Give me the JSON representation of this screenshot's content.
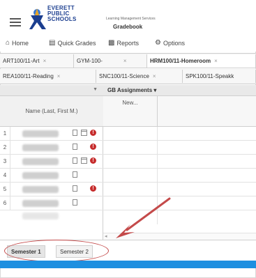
{
  "header": {
    "logo_lines": [
      "EVERETT",
      "PUBLIC",
      "SCHOOLS"
    ],
    "subtitle": "Learning Management Services",
    "app_title": "Gradebook"
  },
  "toolbar": {
    "home": "Home",
    "quick_grades": "Quick Grades",
    "reports": "Reports",
    "options": "Options"
  },
  "class_tabs_row1": [
    {
      "label": "ART100/11-Art",
      "active": false
    },
    {
      "label": "GYM-100-",
      "active": false
    },
    {
      "label": "HRM100/11-Homeroom",
      "active": true
    }
  ],
  "class_tabs_row2": [
    {
      "label": "REA100/11-Reading",
      "active": false
    },
    {
      "label": "SNC100/11-Science",
      "active": false
    },
    {
      "label": "SPK100/11-Speakk",
      "active": false
    }
  ],
  "grid": {
    "name_header": "Name (Last, First M.)",
    "assignments_header": "GB Assignments",
    "new_column": "New...",
    "rows": [
      {
        "num": "1",
        "cal": true,
        "warn": true
      },
      {
        "num": "2",
        "cal": false,
        "warn": true
      },
      {
        "num": "3",
        "cal": true,
        "warn": true
      },
      {
        "num": "4",
        "cal": false,
        "warn": false
      },
      {
        "num": "5",
        "cal": false,
        "warn": true
      },
      {
        "num": "6",
        "cal": false,
        "warn": false
      }
    ]
  },
  "semester_tabs": [
    {
      "label": "Semester 1",
      "active": true
    },
    {
      "label": "Semester 2",
      "active": false
    }
  ],
  "colors": {
    "accent_bar": "#1d8fe0",
    "annotation": "#c44a4a",
    "warning": "#c62d2d"
  }
}
